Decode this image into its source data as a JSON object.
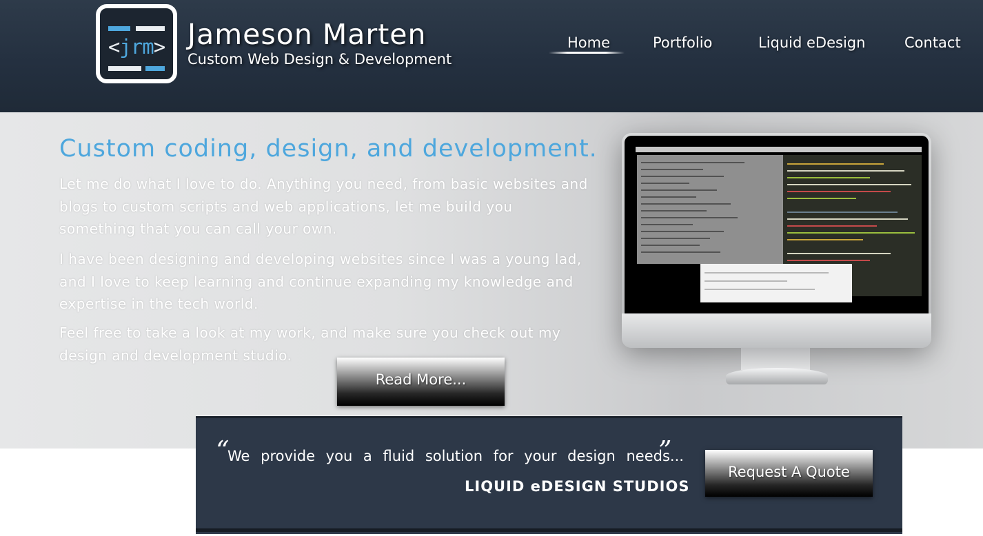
{
  "header": {
    "logo_text": "<jrm>",
    "name": "Jameson Marten",
    "tagline": "Custom Web Design & Development"
  },
  "nav": {
    "items": [
      {
        "label": "Home",
        "active": true
      },
      {
        "label": "Portfolio"
      },
      {
        "label": "Liquid eDesign"
      },
      {
        "label": "Contact"
      }
    ]
  },
  "hero": {
    "title": "Custom coding, design, and development.",
    "paragraphs": [
      "Let me do what I love to do.  Anything you need, from basic websites and blogs to custom scripts and web applications, let me build you something that you can call your own.",
      "I have been designing and developing websites since I was a young lad, and I love to keep learning and continue expanding my knowledge and expertise in the tech world.",
      "Feel free to take a look at my work, and make sure you check out my design and development studio."
    ],
    "read_more_label": "Read More..."
  },
  "quote": {
    "open_mark": "“",
    "close_mark": "”",
    "text": "We provide you a fluid solution for your design needs...",
    "attribution": "LIQUID eDESIGN STUDIOS",
    "button_label": "Request A Quote"
  },
  "colors": {
    "header_bg": "#243040",
    "accent_blue": "#4ea7dd",
    "quote_bg": "#2d3848",
    "hero_bg": "#dfe0e1"
  },
  "icons": {
    "logo": "jrm-logo-icon",
    "monitor": "imac-monitor-illustration"
  }
}
